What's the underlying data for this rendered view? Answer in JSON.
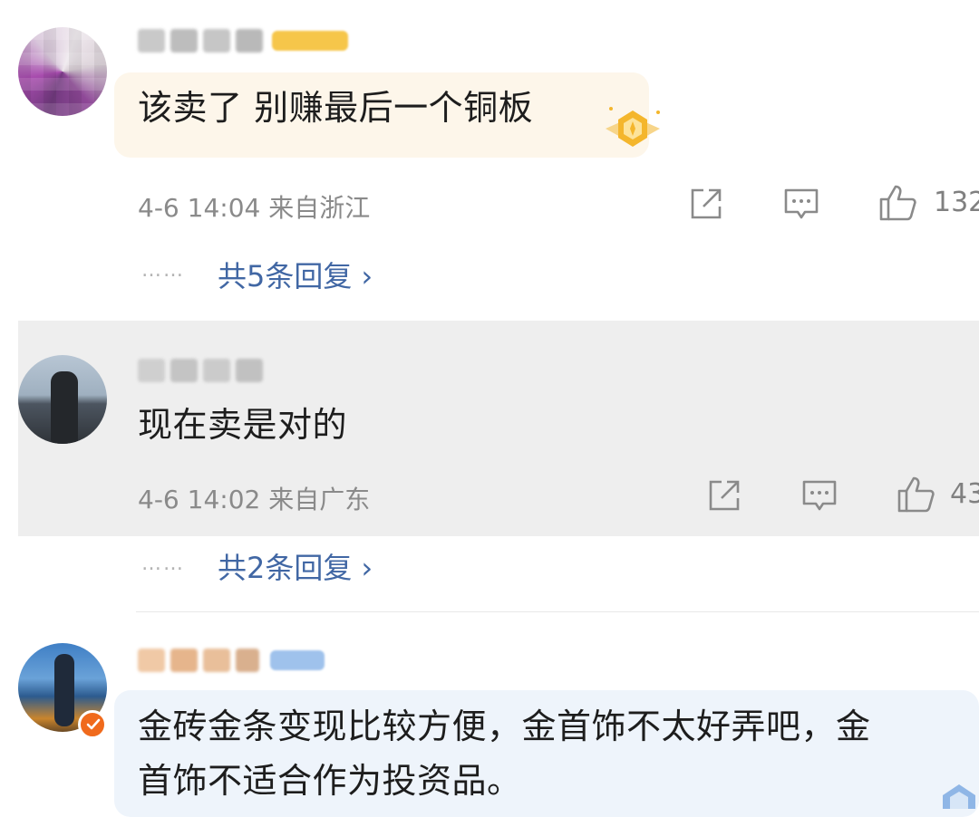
{
  "comments": [
    {
      "text": "该卖了 别赚最后一个铜板",
      "time": "4-6 14:04",
      "location": "来自浙江",
      "likes": "132",
      "replies_link": "共5条回复",
      "replies_dots": "……",
      "replies_arrow": "›"
    },
    {
      "text": "现在卖是对的",
      "time": "4-6 14:02",
      "location": "来自广东",
      "likes": "43",
      "replies_link": "共2条回复",
      "replies_dots": "……",
      "replies_arrow": "›"
    },
    {
      "text_line1": "金砖金条变现比较方便，金首饰不太好弄吧，金",
      "text_line2": "首饰不适合作为投资品。"
    }
  ],
  "colors": {
    "link": "#4167a4",
    "meta": "#8a8a8a",
    "highlight_row": "#eeeeee",
    "bubble_gold": "#fdf6ea",
    "bubble_blue": "#eef4fb",
    "verified_badge": "#f06a1c"
  },
  "icons": [
    "share-icon",
    "comment-icon",
    "like-icon",
    "chevron-right-icon",
    "medal-icon",
    "verified-icon"
  ]
}
